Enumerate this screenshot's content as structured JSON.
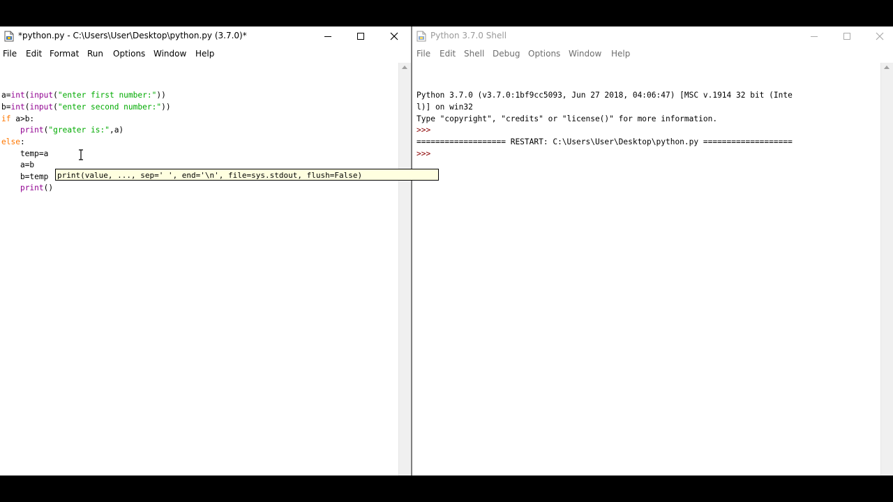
{
  "editor": {
    "title": "*python.py - C:\\Users\\User\\Desktop\\python.py (3.7.0)*",
    "menu": [
      "File",
      "Edit",
      "Format",
      "Run",
      "Options",
      "Window",
      "Help"
    ],
    "code": {
      "l1a": "a=",
      "l1b": "int",
      "l1c": "(",
      "l1d": "input",
      "l1e": "(",
      "l1f": "\"enter first number:\"",
      "l1g": "))",
      "l2a": "b=",
      "l2b": "int",
      "l2c": "(",
      "l2d": "input",
      "l2e": "(",
      "l2f": "\"enter second number:\"",
      "l2g": "))",
      "l3a": "if",
      "l3b": " a>b:",
      "l4a": "    ",
      "l4b": "print",
      "l4c": "(",
      "l4d": "\"greater is:\"",
      "l4e": ",a)",
      "l5a": "else",
      "l5b": ":",
      "l6": "    temp=a",
      "l7": "    a=b",
      "l8": "    b=temp",
      "l9a": "    ",
      "l9b": "print",
      "l9c": "()"
    },
    "tooltip": "print(value, ..., sep=' ', end='\\n', file=sys.stdout, flush=False)"
  },
  "shell": {
    "title": "Python 3.7.0 Shell",
    "menu": [
      "File",
      "Edit",
      "Shell",
      "Debug",
      "Options",
      "Window",
      "Help"
    ],
    "lines": {
      "l1": "Python 3.7.0 (v3.7.0:1bf9cc5093, Jun 27 2018, 04:06:47) [MSC v.1914 32 bit (Inte",
      "l2": "l)] on win32",
      "l3": "Type \"copyright\", \"credits\" or \"license()\" for more information.",
      "p1": ">>> ",
      "l5": "=================== RESTART: C:\\Users\\User\\Desktop\\python.py ===================",
      "p2": ">>> "
    }
  }
}
